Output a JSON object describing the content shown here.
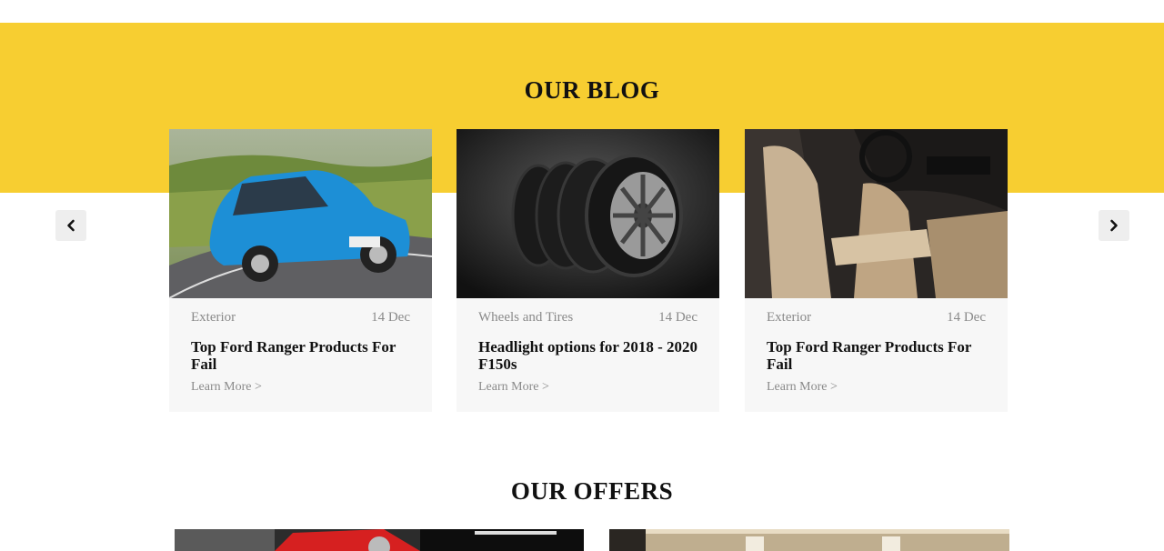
{
  "blog": {
    "title": "OUR BLOG",
    "posts": [
      {
        "category": "Exterior",
        "date": "14 Dec",
        "title": "Top Ford Ranger Products For Fail",
        "link": "Learn More >",
        "image": "blue-hatchback-car"
      },
      {
        "category": "Wheels and Tires",
        "date": "14 Dec",
        "title": "Headlight options for 2018 - 2020 F150s",
        "link": "Learn More >",
        "image": "stacked-tires"
      },
      {
        "category": "Exterior",
        "date": "14 Dec",
        "title": "Top Ford Ranger Products For Fail",
        "link": "Learn More >",
        "image": "car-interior-seats"
      }
    ],
    "nav": {
      "prev_icon": "chevron-left-icon",
      "next_icon": "chevron-right-icon"
    }
  },
  "offers": {
    "title": "OUR OFFERS",
    "images": [
      "red-car-showroom",
      "showroom-interior"
    ]
  },
  "colors": {
    "accent": "#f7ce31",
    "card_bg": "#f7f7f7",
    "muted_text": "#8a8a8a"
  }
}
